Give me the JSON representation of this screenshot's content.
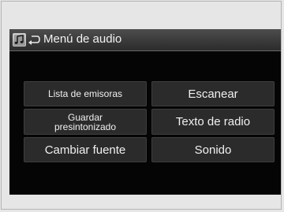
{
  "header": {
    "title": "Menú de audio",
    "icon": "music-note-icon",
    "back_icon": "back-arrow-icon"
  },
  "menu": {
    "station_list": "Lista de emisoras",
    "scan": "Escanear",
    "save_preset_line1": "Guardar",
    "save_preset_line2": "presintonizado",
    "radio_text": "Texto de radio",
    "change_source": "Cambiar fuente",
    "sound": "Sonido"
  },
  "colors": {
    "screen_background": "#050505",
    "button_background": "#2b2b2b",
    "text": "#f0f0f0"
  }
}
